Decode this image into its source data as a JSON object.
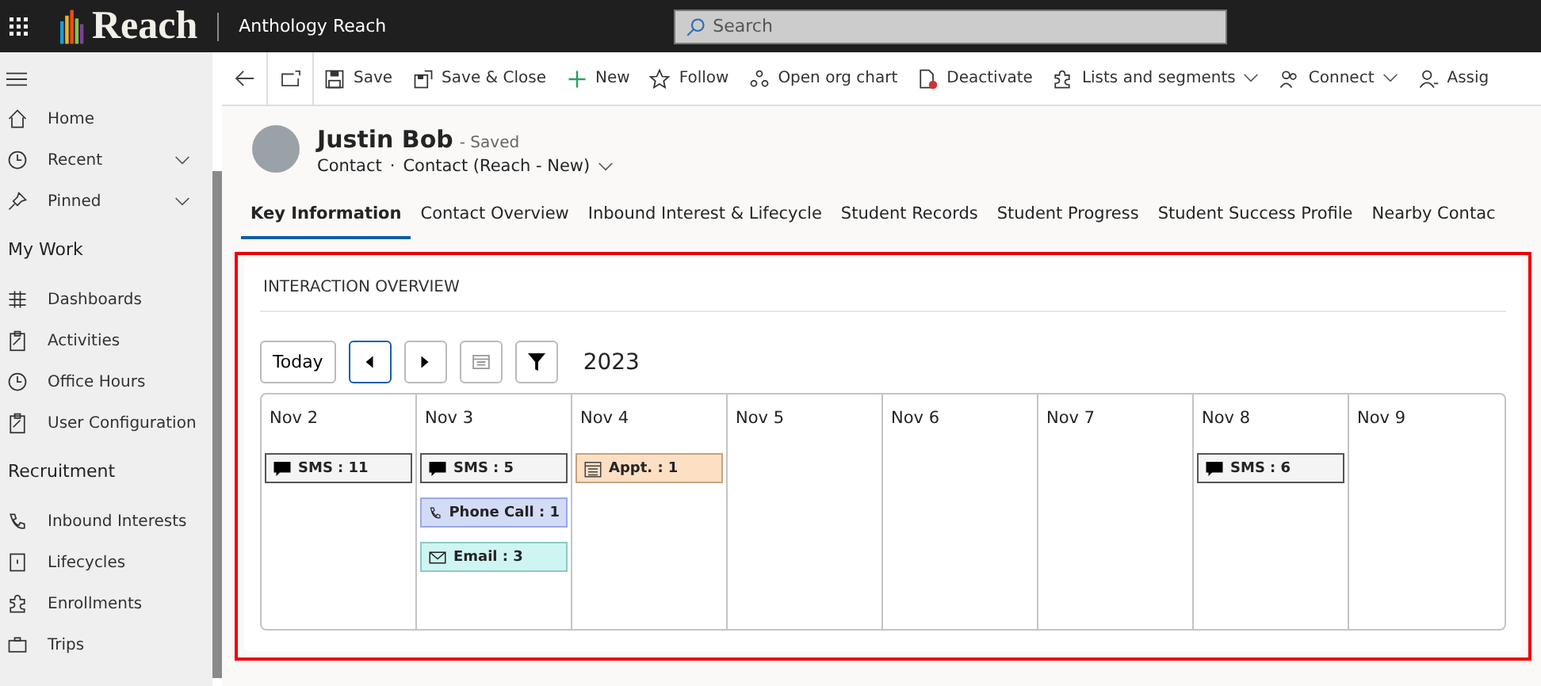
{
  "top_bar": {
    "brand": "Reach",
    "app_name": "Anthology Reach",
    "search": {
      "placeholder": "Search"
    }
  },
  "sidebar": {
    "sections": [
      {
        "items": [
          {
            "label": "Home",
            "chevron": false
          },
          {
            "label": "Recent",
            "chevron": true
          },
          {
            "label": "Pinned",
            "chevron": true
          }
        ]
      },
      {
        "heading": "My Work",
        "items": [
          {
            "label": "Dashboards",
            "chevron": false
          },
          {
            "label": "Activities",
            "chevron": false
          },
          {
            "label": "Office Hours",
            "chevron": false
          },
          {
            "label": "User Configuration",
            "chevron": false
          }
        ]
      },
      {
        "heading": "Recruitment",
        "items": [
          {
            "label": "Inbound Interests",
            "chevron": false
          },
          {
            "label": "Lifecycles",
            "chevron": false
          },
          {
            "label": "Enrollments",
            "chevron": false
          },
          {
            "label": "Trips",
            "chevron": false
          }
        ]
      }
    ]
  },
  "command_bar": [
    {
      "label": "Save",
      "dropdown": false
    },
    {
      "label": "Save & Close",
      "dropdown": false
    },
    {
      "label": "New",
      "dropdown": false
    },
    {
      "label": "Follow",
      "dropdown": false
    },
    {
      "label": "Open org chart",
      "dropdown": false
    },
    {
      "label": "Deactivate",
      "dropdown": false
    },
    {
      "label": "Lists and segments",
      "dropdown": true
    },
    {
      "label": "Connect",
      "dropdown": true
    },
    {
      "label": "Assig",
      "dropdown": false
    }
  ],
  "record": {
    "name": "Justin Bob",
    "status": "- Saved",
    "entity": "Contact",
    "separator": "·",
    "form": "Contact (Reach - New)"
  },
  "tabs": [
    {
      "label": "Key Information",
      "selected": true
    },
    {
      "label": "Contact Overview",
      "selected": false
    },
    {
      "label": "Inbound Interest & Lifecycle",
      "selected": false
    },
    {
      "label": "Student Records",
      "selected": false
    },
    {
      "label": "Student Progress",
      "selected": false
    },
    {
      "label": "Student Success Profile",
      "selected": false
    },
    {
      "label": "Nearby Contac",
      "selected": false
    }
  ],
  "interaction_overview": {
    "title": "INTERACTION OVERVIEW",
    "today_button": "Today",
    "year": "2023",
    "days": [
      {
        "date": "Nov 2",
        "events": [
          {
            "kind": "sms",
            "label": "SMS : 11",
            "color": "#f4f4f4"
          }
        ]
      },
      {
        "date": "Nov 3",
        "events": [
          {
            "kind": "sms",
            "label": "SMS : 5",
            "color": "#f4f4f4"
          },
          {
            "kind": "phone",
            "label": "Phone Call : 1",
            "color": "#d3dcf7"
          },
          {
            "kind": "email",
            "label": "Email : 3",
            "color": "#cff5f2"
          }
        ]
      },
      {
        "date": "Nov 4",
        "events": [
          {
            "kind": "appointment",
            "label": "Appt. : 1",
            "color": "#fddfc4"
          }
        ]
      },
      {
        "date": "Nov 5"
      },
      {
        "date": "Nov 6"
      },
      {
        "date": "Nov 7"
      },
      {
        "date": "Nov 8",
        "events": [
          {
            "kind": "sms",
            "label": "SMS : 6",
            "color": "#f4f4f4"
          }
        ]
      },
      {
        "date": "Nov 9"
      }
    ]
  }
}
